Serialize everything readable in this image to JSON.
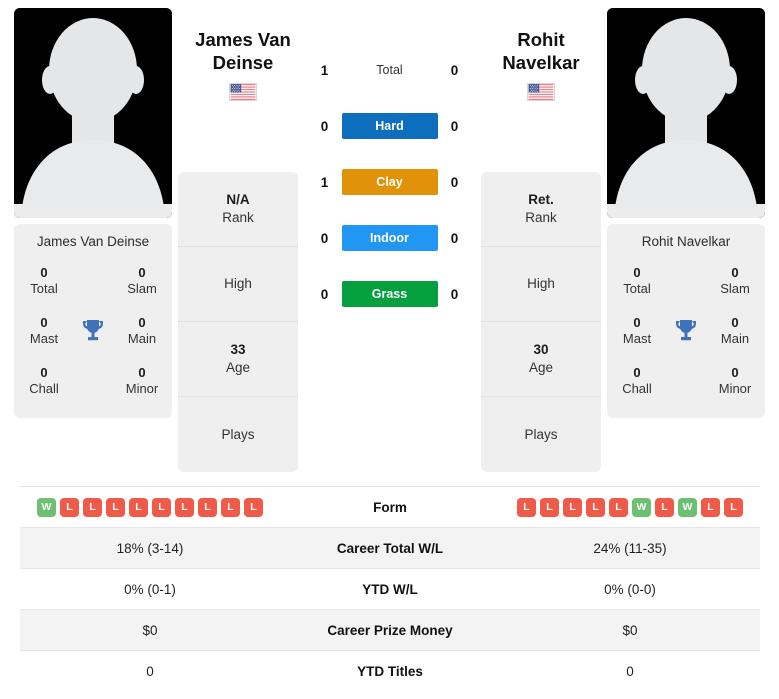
{
  "players": {
    "left": {
      "name_display": "James Van\nDeinse",
      "name_line1": "James Van",
      "name_line2": "Deinse",
      "card_name": "James Van Deinse",
      "flag": "us-flag-icon",
      "rank_value": "N/A",
      "rank_label": "Rank",
      "high_value": "",
      "high_label": "High",
      "age_value": "33",
      "age_label": "Age",
      "plays_value": "",
      "plays_label": "Plays",
      "titles": {
        "total_value": "0",
        "total_label": "Total",
        "slam_value": "0",
        "slam_label": "Slam",
        "mast_value": "0",
        "mast_label": "Mast",
        "main_value": "0",
        "main_label": "Main",
        "chall_value": "0",
        "chall_label": "Chall",
        "minor_value": "0",
        "minor_label": "Minor"
      },
      "form": [
        "W",
        "L",
        "L",
        "L",
        "L",
        "L",
        "L",
        "L",
        "L",
        "L"
      ],
      "career_total_wl": "18% (3-14)",
      "ytd_wl": "0% (0-1)",
      "career_prize_money": "$0",
      "ytd_titles": "0"
    },
    "right": {
      "name_display": "Rohit\nNavelkar",
      "name_line1": "Rohit",
      "name_line2": "Navelkar",
      "card_name": "Rohit Navelkar",
      "flag": "us-flag-icon",
      "rank_value": "Ret.",
      "rank_label": "Rank",
      "high_value": "",
      "high_label": "High",
      "age_value": "30",
      "age_label": "Age",
      "plays_value": "",
      "plays_label": "Plays",
      "titles": {
        "total_value": "0",
        "total_label": "Total",
        "slam_value": "0",
        "slam_label": "Slam",
        "mast_value": "0",
        "mast_label": "Mast",
        "main_value": "0",
        "main_label": "Main",
        "chall_value": "0",
        "chall_label": "Chall",
        "minor_value": "0",
        "minor_label": "Minor"
      },
      "form": [
        "L",
        "L",
        "L",
        "L",
        "L",
        "W",
        "L",
        "W",
        "L",
        "L"
      ],
      "career_total_wl": "24% (11-35)",
      "ytd_wl": "0% (0-0)",
      "career_prize_money": "$0",
      "ytd_titles": "0"
    }
  },
  "head_to_head": {
    "rows": [
      {
        "label": "Total",
        "left": "1",
        "right": "0",
        "color": "",
        "plain": true
      },
      {
        "label": "Hard",
        "left": "0",
        "right": "0",
        "color": "#0d6ebd",
        "plain": false
      },
      {
        "label": "Clay",
        "left": "1",
        "right": "0",
        "color": "#e19208",
        "plain": false
      },
      {
        "label": "Indoor",
        "left": "0",
        "right": "0",
        "color": "#2196f3",
        "plain": false
      },
      {
        "label": "Grass",
        "left": "0",
        "right": "0",
        "color": "#049f3e",
        "plain": false
      }
    ]
  },
  "stats_table": {
    "rows": [
      {
        "label": "Form",
        "type": "form",
        "left": "",
        "right": ""
      },
      {
        "label": "Career Total W/L",
        "type": "text",
        "left": "18% (3-14)",
        "right": "24% (11-35)"
      },
      {
        "label": "YTD W/L",
        "type": "text",
        "left": "0% (0-1)",
        "right": "0% (0-0)"
      },
      {
        "label": "Career Prize Money",
        "type": "text",
        "left": "$0",
        "right": "$0"
      },
      {
        "label": "YTD Titles",
        "type": "text",
        "left": "0",
        "right": "0"
      }
    ]
  },
  "colors": {
    "hard": "#0d6ebd",
    "clay": "#e19208",
    "indoor": "#2196f3",
    "grass": "#049f3e",
    "win": "#6cc070",
    "loss": "#ef5b48",
    "trophy": "#3f72b8",
    "card_bg": "#efefef"
  }
}
